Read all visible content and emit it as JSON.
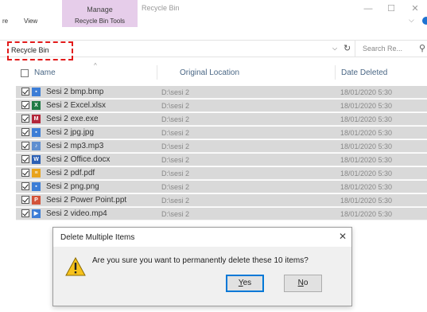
{
  "window": {
    "title": "Recycle Bin",
    "context_tab": "Manage",
    "context_group": "Recycle Bin Tools",
    "tabs": [
      "re",
      "View"
    ],
    "controls": [
      "—",
      "☐",
      "✕"
    ]
  },
  "address": {
    "path": "Recycle Bin",
    "search_placeholder": "Search Re..."
  },
  "columns": {
    "name": "Name",
    "location": "Original Location",
    "date": "Date Deleted"
  },
  "files": [
    {
      "name": "Sesi 2 bmp.bmp",
      "location": "D:\\sesi 2",
      "date": "18/01/2020 5:30",
      "icon": "image-file-icon",
      "color": "#3c7dd6",
      "glyph": "▪"
    },
    {
      "name": "Sesi 2 Excel.xlsx",
      "location": "D:\\sesi 2",
      "date": "18/01/2020 5:30",
      "icon": "excel-file-icon",
      "color": "#1e7a44",
      "glyph": "X"
    },
    {
      "name": "Sesi 2 exe.exe",
      "location": "D:\\sesi 2",
      "date": "18/01/2020 5:30",
      "icon": "exe-file-icon",
      "color": "#b3263a",
      "glyph": "M"
    },
    {
      "name": "Sesi 2 jpg.jpg",
      "location": "D:\\sesi 2",
      "date": "18/01/2020 5:30",
      "icon": "image-file-icon",
      "color": "#3c7dd6",
      "glyph": "▪"
    },
    {
      "name": "Sesi 2 mp3.mp3",
      "location": "D:\\sesi 2",
      "date": "18/01/2020 5:30",
      "icon": "audio-file-icon",
      "color": "#5f8fd0",
      "glyph": "♪"
    },
    {
      "name": "Sesi 2 Office.docx",
      "location": "D:\\sesi 2",
      "date": "18/01/2020 5:30",
      "icon": "word-file-icon",
      "color": "#2b5fb4",
      "glyph": "W"
    },
    {
      "name": "Sesi 2 pdf.pdf",
      "location": "D:\\sesi 2",
      "date": "18/01/2020 5:30",
      "icon": "pdf-file-icon",
      "color": "#e8a31d",
      "glyph": "≡"
    },
    {
      "name": "Sesi 2 png.png",
      "location": "D:\\sesi 2",
      "date": "18/01/2020 5:30",
      "icon": "image-file-icon",
      "color": "#3c7dd6",
      "glyph": "▪"
    },
    {
      "name": "Sesi 2 Power Point.ppt",
      "location": "D:\\sesi 2",
      "date": "18/01/2020 5:30",
      "icon": "powerpoint-file-icon",
      "color": "#d2533a",
      "glyph": "P"
    },
    {
      "name": "Sesi 2 video.mp4",
      "location": "D:\\sesi 2",
      "date": "18/01/2020 5:30",
      "icon": "video-file-icon",
      "color": "#3c7dd6",
      "glyph": "▶"
    }
  ],
  "dialog": {
    "title": "Delete Multiple Items",
    "message": "Are you sure you want to permanently delete these 10 items?",
    "yes_accel": "Y",
    "yes_rest": "es",
    "no_accel": "N",
    "no_rest": "o",
    "close": "✕"
  },
  "colors": {
    "manage_tab": "#e6cdea",
    "highlight_box": "#e21b1b",
    "selected_row": "#d9d9d9",
    "default_button_border": "#0078d7"
  }
}
